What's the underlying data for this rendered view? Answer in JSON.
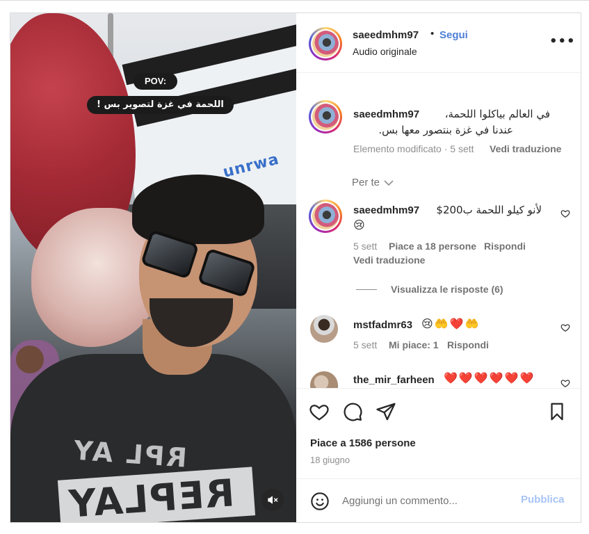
{
  "media": {
    "pov_label": "POV:",
    "caption_overlay": "اللحمة في غزة لتصوير بس !",
    "shirt_text_top": "RPL AY",
    "shirt_text_band": "REPLAY",
    "tarp_text": "unrwa"
  },
  "header": {
    "username": "saeedmhm97",
    "dot": "•",
    "follow_label": "Segui",
    "audio_label": "Audio originale",
    "more_label": "•••"
  },
  "post_caption": {
    "username": "saeedmhm97",
    "line1": "في العالم بياكلوا اللحمة،",
    "line2": "عندنا في غزة بنتصور معها بس.",
    "edited": "Elemento modificato · 5 sett",
    "translate": "Vedi traduzione"
  },
  "for_you_label": "Per te",
  "comments": [
    {
      "username": "saeedmhm97",
      "text": "لأنو كيلو اللحمة ب200$",
      "emoji": "😢",
      "time": "5 sett",
      "likes": "Piace a 18 persone",
      "reply": "Rispondi",
      "translate": "Vedi traduzione",
      "view_replies": "Visualizza le risposte (6)"
    },
    {
      "username": "mstfadmr63",
      "emoji": "😢🤲❤️🤲",
      "time": "5 sett",
      "likes": "Mi piace: 1",
      "reply": "Rispondi"
    },
    {
      "username": "the_mir_farheen",
      "emoji": "❤️❤️❤️❤️❤️❤️",
      "emoji2": "😍😍😍😍😍😍😍😍😍"
    }
  ],
  "likes_total": "Piace a 1586 persone",
  "post_date": "18 giugno",
  "composer": {
    "placeholder": "Aggiungi un commento...",
    "publish_label": "Pubblica"
  },
  "colors": {
    "accent": "#4f7fd6",
    "muted": "#8e8e8e",
    "publish_disabled": "#a8c4f5",
    "border": "#dbdbdb"
  }
}
